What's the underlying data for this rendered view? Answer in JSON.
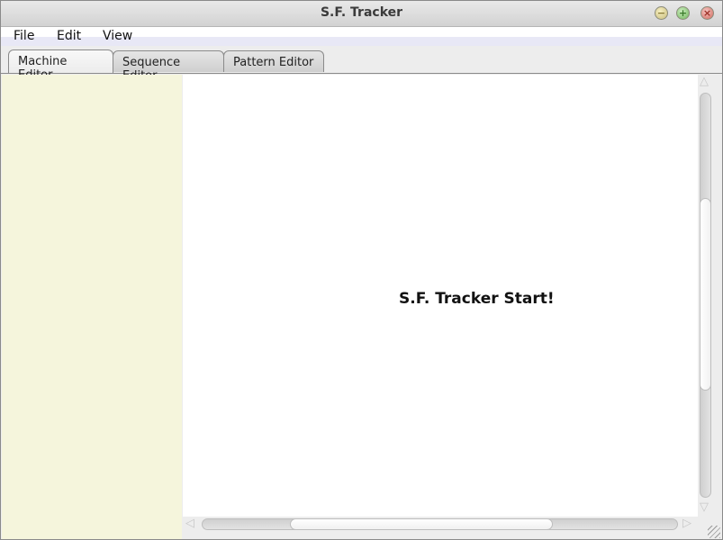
{
  "window": {
    "title": "S.F. Tracker",
    "controls": {
      "minimize_icon": "−",
      "maximize_icon": "+",
      "close_icon": "×"
    }
  },
  "menubar": {
    "items": [
      {
        "label": "File"
      },
      {
        "label": "Edit"
      },
      {
        "label": "View"
      }
    ]
  },
  "tabs": [
    {
      "label": "Machine Editor",
      "active": true
    },
    {
      "label": "Sequence Editor",
      "active": false
    },
    {
      "label": "Pattern Editor",
      "active": false
    }
  ],
  "main": {
    "start_message": "S.F. Tracker Start!"
  },
  "scrollbars": {
    "up_arrow": "△",
    "down_arrow": "▽",
    "left_arrow": "◁",
    "right_arrow": "▷"
  },
  "colors": {
    "left_pane": "#f5f5dc",
    "canvas": "#ffffff"
  }
}
